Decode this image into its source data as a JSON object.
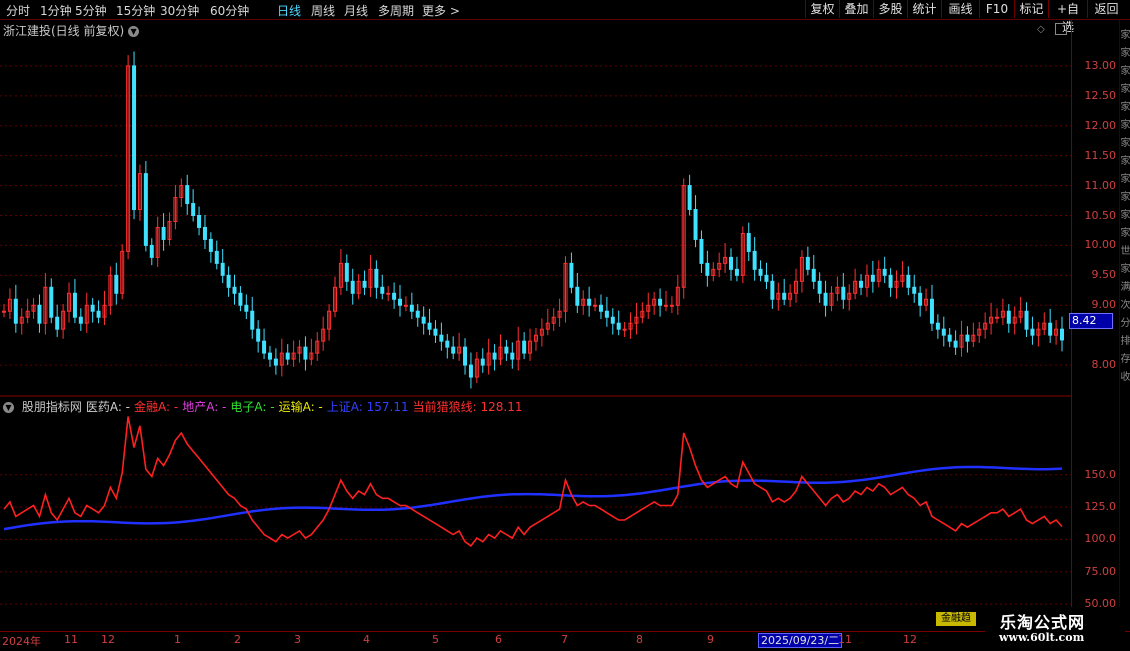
{
  "toolbar": {
    "periods": [
      {
        "label": "分时",
        "active": false
      },
      {
        "label": "1分钟",
        "active": false
      },
      {
        "label": "5分钟",
        "active": false
      },
      {
        "label": "15分钟",
        "active": false
      },
      {
        "label": "30分钟",
        "active": false
      },
      {
        "label": "60分钟",
        "active": false
      },
      {
        "label": "日线",
        "active": true
      },
      {
        "label": "周线",
        "active": false
      },
      {
        "label": "月线",
        "active": false
      },
      {
        "label": "多周期",
        "active": false
      },
      {
        "label": "更多",
        "active": false
      }
    ],
    "more_chevron": ">",
    "buttons": [
      "复权",
      "叠加",
      "多股",
      "统计",
      "画线",
      "F10",
      "标记",
      "+自选",
      "返回"
    ]
  },
  "main_chart": {
    "title": "浙江建投(日线 前复权)",
    "last_price": "8.42",
    "y_ticks": [
      "13.00",
      "12.50",
      "12.00",
      "11.50",
      "11.00",
      "10.50",
      "10.00",
      "9.50",
      "9.00",
      "8.00"
    ]
  },
  "indicator": {
    "name": "股朋指标网",
    "items": [
      {
        "label": "医药A: -",
        "color": "#d0d0d0"
      },
      {
        "label": "金融A: -",
        "color": "#ff3030"
      },
      {
        "label": "地产A: -",
        "color": "#e040e0"
      },
      {
        "label": "电子A: -",
        "color": "#30e030"
      },
      {
        "label": "运输A: -",
        "color": "#e8e800"
      },
      {
        "label": "上证A: 157.11",
        "color": "#3040ff"
      },
      {
        "label": "当前猎狼线: 128.11",
        "color": "#ff3030"
      }
    ],
    "y_ticks": [
      "150.0",
      "125.0",
      "100.0",
      "75.00",
      "50.00"
    ]
  },
  "date_axis": {
    "labels": [
      "2024年",
      "11",
      "12",
      "1",
      "2",
      "3",
      "4",
      "5",
      "6",
      "7",
      "8",
      "9",
      "11",
      "12"
    ],
    "cursor": "2025/09/23/二"
  },
  "right_strip": {
    "chars": [
      "家",
      "家",
      "家",
      "家",
      "家",
      "家",
      "家",
      "家",
      "家",
      "家",
      "家",
      "家",
      "世",
      "家",
      "满",
      "次",
      "分",
      "排",
      "存",
      "收"
    ]
  },
  "badge": "金融趋",
  "watermark": {
    "title": "乐淘公式网",
    "url": "www.60lt.com"
  },
  "colors": {
    "up": "#ff3030",
    "down": "#40e0ff",
    "index_line": "#2030ff",
    "wolf_line": "#ff2020",
    "grid": "#600000"
  },
  "chart_data": {
    "type": "candlestick",
    "title": "浙江建投(日线 前复权)",
    "y_range": [
      7.5,
      13.5
    ],
    "close_series": [
      8.9,
      9.1,
      8.7,
      8.8,
      8.9,
      9.0,
      8.7,
      9.3,
      8.8,
      8.6,
      8.9,
      9.2,
      8.8,
      8.7,
      9.0,
      8.9,
      8.8,
      9.0,
      9.5,
      9.2,
      9.9,
      13.0,
      10.6,
      11.2,
      10.0,
      9.8,
      10.3,
      10.1,
      10.4,
      10.8,
      11.0,
      10.7,
      10.5,
      10.3,
      10.1,
      9.9,
      9.7,
      9.5,
      9.3,
      9.2,
      9.0,
      8.9,
      8.6,
      8.4,
      8.2,
      8.1,
      8.0,
      8.2,
      8.1,
      8.2,
      8.3,
      8.1,
      8.2,
      8.4,
      8.6,
      8.9,
      9.3,
      9.7,
      9.4,
      9.2,
      9.4,
      9.3,
      9.6,
      9.3,
      9.2,
      9.2,
      9.1,
      9.0,
      9.0,
      8.9,
      8.8,
      8.7,
      8.6,
      8.5,
      8.4,
      8.3,
      8.2,
      8.3,
      8.0,
      7.8,
      8.1,
      8.0,
      8.2,
      8.1,
      8.3,
      8.2,
      8.1,
      8.4,
      8.2,
      8.4,
      8.5,
      8.6,
      8.7,
      8.8,
      8.9,
      9.7,
      9.3,
      9.0,
      9.1,
      9.0,
      9.0,
      8.9,
      8.8,
      8.7,
      8.6,
      8.6,
      8.7,
      8.8,
      8.9,
      9.0,
      9.1,
      9.0,
      9.0,
      9.0,
      9.3,
      11.0,
      10.6,
      10.1,
      9.7,
      9.5,
      9.6,
      9.7,
      9.8,
      9.6,
      9.5,
      10.2,
      9.9,
      9.6,
      9.5,
      9.4,
      9.1,
      9.2,
      9.1,
      9.2,
      9.4,
      9.8,
      9.6,
      9.4,
      9.2,
      9.0,
      9.2,
      9.3,
      9.1,
      9.2,
      9.4,
      9.3,
      9.5,
      9.4,
      9.6,
      9.5,
      9.3,
      9.4,
      9.5,
      9.3,
      9.2,
      9.0,
      9.1,
      8.7,
      8.6,
      8.5,
      8.4,
      8.3,
      8.5,
      8.4,
      8.5,
      8.6,
      8.7,
      8.8,
      8.8,
      8.9,
      8.7,
      8.8,
      8.9,
      8.6,
      8.5,
      8.6,
      8.7,
      8.5,
      8.6,
      8.42
    ]
  }
}
